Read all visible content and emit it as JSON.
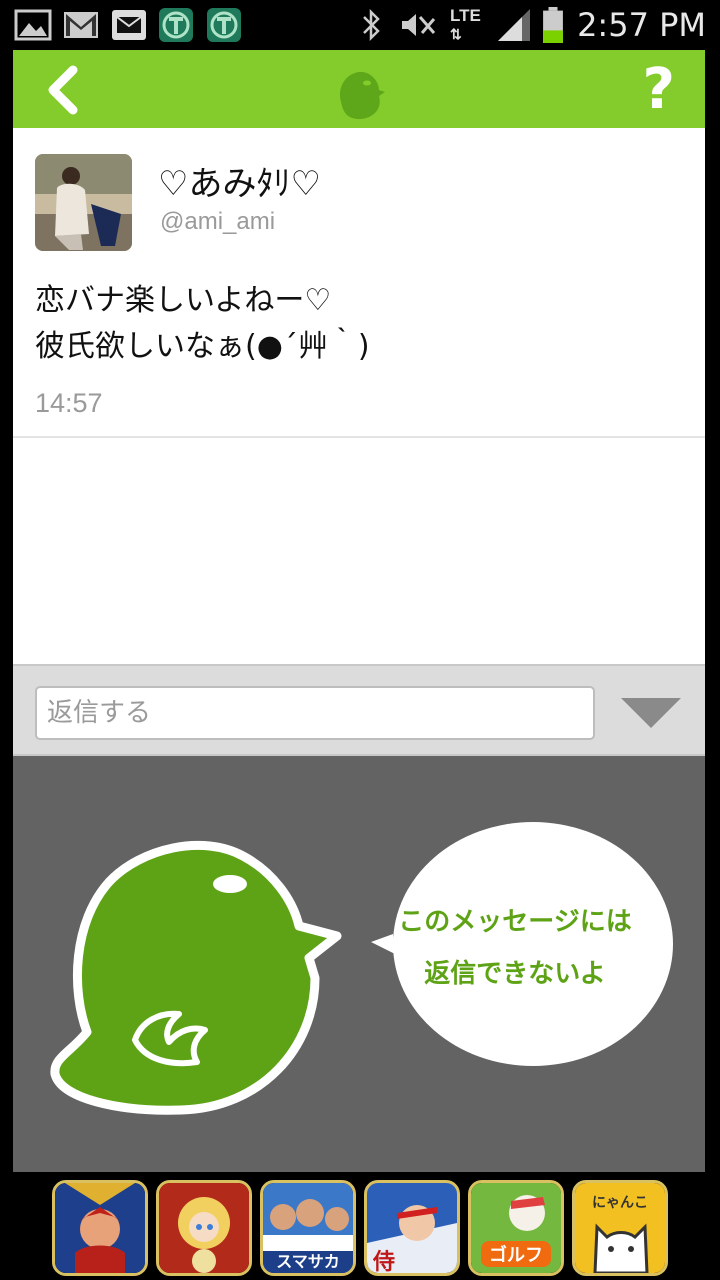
{
  "status_bar": {
    "time": "2:57 PM",
    "network": "LTE",
    "icons": [
      "gallery-icon",
      "gmail-icon",
      "mail-icon",
      "app-t-icon",
      "app-t-icon",
      "bluetooth-icon",
      "mute-icon",
      "lte-icon",
      "signal-icon",
      "battery-icon"
    ]
  },
  "header": {
    "help_label": "?",
    "colors": {
      "accent": "#84cc2c"
    }
  },
  "tweet": {
    "display_name": "♡あみﾀﾘ♡",
    "handle": "@ami_ami",
    "text": "恋バナ楽しいよねー♡\n彼氏欲しいなぁ(●´艸｀)",
    "time": "14:57"
  },
  "reply": {
    "placeholder": "返信する"
  },
  "notice": {
    "line1": "このメッセージには",
    "line2": "返信できないよ",
    "colors": {
      "bird": "#5ea316",
      "background": "#636363"
    }
  },
  "ads": {
    "items": [
      {
        "icon": "ad-warlord-icon",
        "label": ""
      },
      {
        "icon": "ad-princess-icon",
        "label": ""
      },
      {
        "icon": "ad-soccer-icon",
        "label": "スマサカ"
      },
      {
        "icon": "ad-tennis-icon",
        "label": "侍"
      },
      {
        "icon": "ad-golf-icon",
        "label": "ゴルフ"
      },
      {
        "icon": "ad-cat-icon",
        "label": "にゃんこ"
      }
    ]
  }
}
